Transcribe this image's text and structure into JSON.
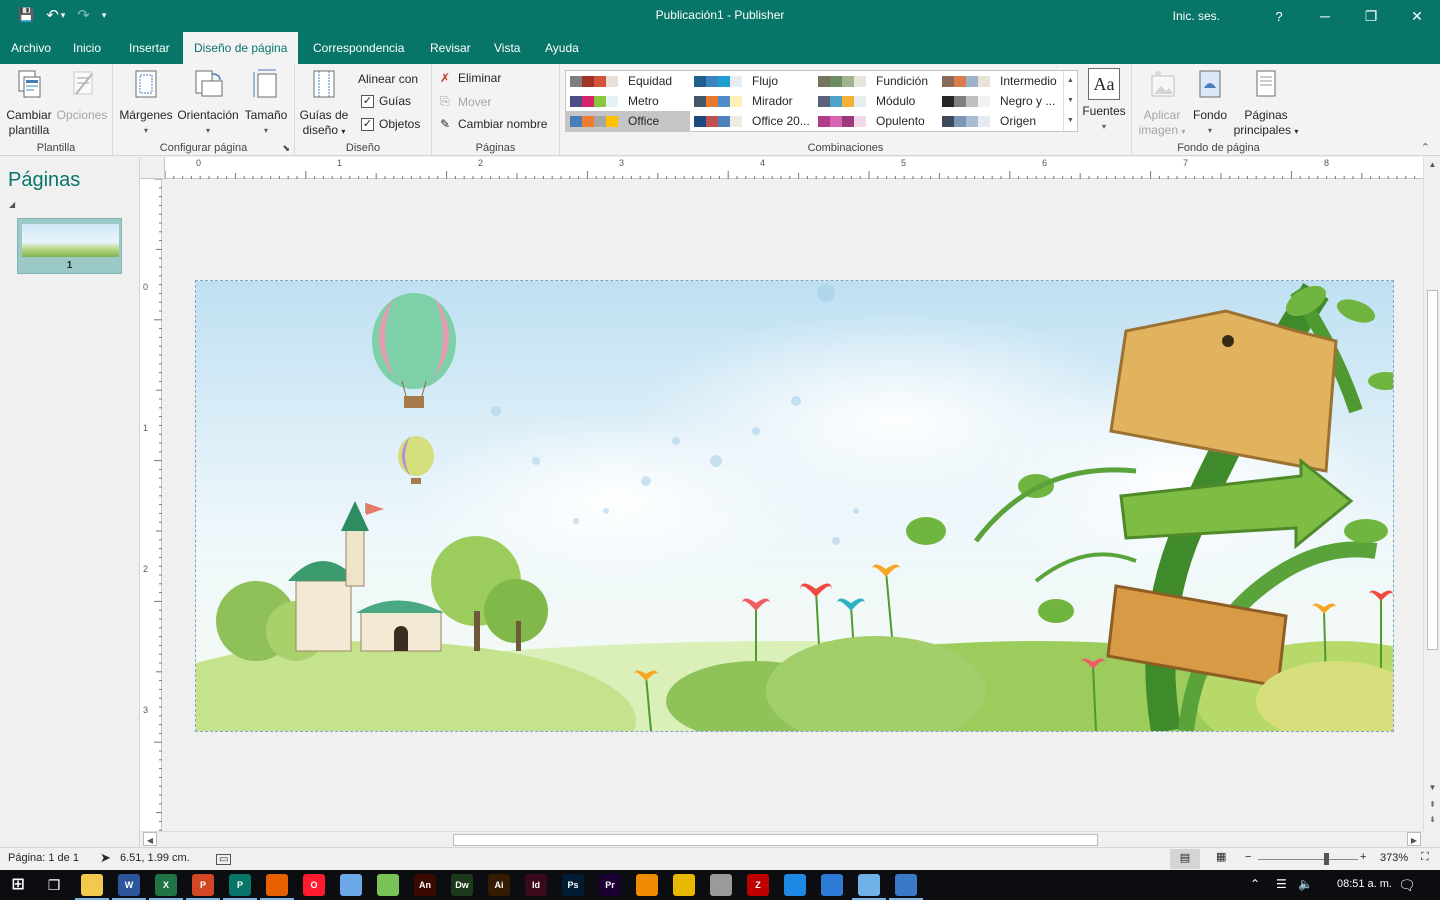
{
  "window": {
    "title": "Publicación1  -  Publisher",
    "signin": "Inic. ses.",
    "help": "?",
    "minimize": "─",
    "restore": "❐",
    "close": "✕"
  },
  "qat": {
    "save": "💾",
    "undo": "↶",
    "undo_caret": "▾",
    "redo": "↷",
    "customize": "▾"
  },
  "tabs": [
    "Archivo",
    "Inicio",
    "Insertar",
    "Diseño de página",
    "Correspondencia",
    "Revisar",
    "Vista",
    "Ayuda"
  ],
  "ribbon": {
    "plantilla": {
      "label": "Plantilla",
      "cambiar": "Cambiar plantilla",
      "cambiar_l1": "Cambiar",
      "cambiar_l2": "plantilla",
      "opciones": "Opciones"
    },
    "configurar": {
      "label": "Configurar página",
      "margenes": "Márgenes",
      "orientacion": "Orientación",
      "tamano": "Tamaño"
    },
    "diseno": {
      "label": "Diseño",
      "guias_l1": "Guías de",
      "guias_l2": "diseño",
      "alinear": "Alinear con",
      "guias": "Guías",
      "objetos": "Objetos",
      "check": "✓"
    },
    "paginas": {
      "label": "Páginas",
      "eliminar": "Eliminar",
      "mover": "Mover",
      "cambiar_nombre": "Cambiar nombre"
    },
    "combinaciones": {
      "label": "Combinaciones",
      "schemes": [
        {
          "name": "Equidad",
          "colors": [
            "#7f7f7f",
            "#a33228",
            "#d2553a",
            "#e8e0d8"
          ]
        },
        {
          "name": "Flujo",
          "colors": [
            "#1f5f8b",
            "#3a84c0",
            "#1e9fd1",
            "#e6eef4"
          ]
        },
        {
          "name": "Fundición",
          "colors": [
            "#76745e",
            "#6e8c61",
            "#a2b48f",
            "#e6e6dc"
          ]
        },
        {
          "name": "Intermedio",
          "colors": [
            "#8c6a5a",
            "#d97b4a",
            "#9fb3c8",
            "#e9e2d8"
          ]
        },
        {
          "name": "Metro",
          "colors": [
            "#4b4f86",
            "#d8236a",
            "#8cc63e",
            "#e4f1f6"
          ]
        },
        {
          "name": "Mirador",
          "colors": [
            "#45556a",
            "#e87a2f",
            "#4f8cc9",
            "#fff1b8"
          ]
        },
        {
          "name": "Módulo",
          "colors": [
            "#5a6378",
            "#4fa3c9",
            "#f2b136",
            "#e9ecef"
          ]
        },
        {
          "name": "Negro y ...",
          "colors": [
            "#262626",
            "#7f7f7f",
            "#bfbfbf",
            "#f2f2f2"
          ]
        },
        {
          "name": "Office",
          "colors": [
            "#4a7ebb",
            "#ed7d31",
            "#a5a5a5",
            "#ffc000"
          ]
        },
        {
          "name": "Office 20...",
          "colors": [
            "#1f497d",
            "#c0504d",
            "#4f81bd",
            "#eeece1"
          ]
        },
        {
          "name": "Opulento",
          "colors": [
            "#b23c8c",
            "#d764b2",
            "#9b3a7a",
            "#f2d8e8"
          ]
        },
        {
          "name": "Origen",
          "colors": [
            "#3d4a5c",
            "#7a95b6",
            "#a8bcd4",
            "#e6ebf1"
          ]
        }
      ]
    },
    "fuentes": {
      "label": "Fuentes",
      "glyph": "Aa"
    },
    "fondo": {
      "label": "Fondo de página",
      "aplicar_l1": "Aplicar",
      "aplicar_l2": "imagen",
      "fondo": "Fondo",
      "principales_l1": "Páginas",
      "principales_l2": "principales"
    },
    "collapse": "⌃"
  },
  "pages_panel": {
    "title": "Páginas",
    "collapse": "◢",
    "thumb_number": "1"
  },
  "rulers": {
    "h": [
      "0",
      "1",
      "2",
      "3",
      "4",
      "5",
      "6",
      "7",
      "8"
    ],
    "v": [
      "0",
      "1",
      "2",
      "3"
    ]
  },
  "status": {
    "page": "Página: 1 de 1",
    "position": "6.51, 1.99 cm.",
    "zoom": "373%",
    "minus": "−",
    "plus": "+"
  },
  "taskbar": {
    "clock": "08:51 a. m.",
    "apps": [
      {
        "name": "file-explorer",
        "label": "",
        "color": "#f2c94c"
      },
      {
        "name": "word",
        "label": "W",
        "color": "#2b579a"
      },
      {
        "name": "excel",
        "label": "X",
        "color": "#217346"
      },
      {
        "name": "powerpoint",
        "label": "P",
        "color": "#d24726"
      },
      {
        "name": "publisher",
        "label": "P",
        "color": "#077568"
      },
      {
        "name": "firefox",
        "label": "",
        "color": "#e66000"
      },
      {
        "name": "opera",
        "label": "O",
        "color": "#ff1b2d"
      },
      {
        "name": "box-app",
        "label": "",
        "color": "#6aa8e8"
      },
      {
        "name": "android",
        "label": "",
        "color": "#78c257"
      },
      {
        "name": "animate",
        "label": "An",
        "color": "#3a0a00"
      },
      {
        "name": "dreamweaver",
        "label": "Dw",
        "color": "#1b3a1b"
      },
      {
        "name": "illustrator",
        "label": "Ai",
        "color": "#331c00"
      },
      {
        "name": "indesign",
        "label": "Id",
        "color": "#3a0a1c"
      },
      {
        "name": "photoshop",
        "label": "Ps",
        "color": "#001d34"
      },
      {
        "name": "premiere",
        "label": "Pr",
        "color": "#1c0033"
      },
      {
        "name": "vlc",
        "label": "",
        "color": "#f08a00"
      },
      {
        "name": "app-yellow",
        "label": "",
        "color": "#e8b800"
      },
      {
        "name": "app-gray",
        "label": "",
        "color": "#9a9a9a"
      },
      {
        "name": "filezilla",
        "label": "Z",
        "color": "#bf0000"
      },
      {
        "name": "app-blue",
        "label": "",
        "color": "#1e88e5"
      },
      {
        "name": "app-notes",
        "label": "",
        "color": "#2d7bd6"
      },
      {
        "name": "app-list",
        "label": "",
        "color": "#6fb1e8"
      },
      {
        "name": "paint",
        "label": "",
        "color": "#3c78c8"
      }
    ]
  }
}
